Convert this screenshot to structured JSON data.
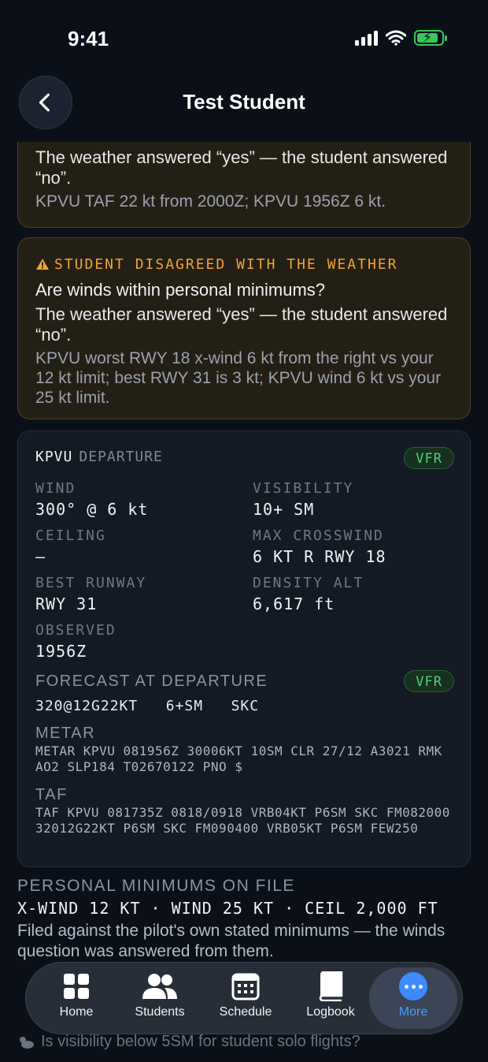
{
  "status_bar": {
    "time": "9:41"
  },
  "header": {
    "title": "Test Student"
  },
  "cards": [
    {
      "answer": "The weather answered “yes” — the student answered “no”.",
      "detail": "KPVU TAF 22 kt from 2000Z; KPVU 1956Z 6 kt."
    },
    {
      "warning": "STUDENT DISAGREED WITH THE WEATHER",
      "question": "Are winds within personal minimums?",
      "answer": "The weather answered “yes” — the student answered “no”.",
      "detail": "KPVU worst RWY 18 x-wind 6 kt from the right vs your 12 kt limit; best RWY 31 is 3 kt; KPVU wind 6 kt vs your 25 kt limit."
    }
  ],
  "weather": {
    "airport": "KPVU",
    "role": "DEPARTURE",
    "category": "VFR",
    "fields": {
      "wind": {
        "label": "WIND",
        "value": "300° @ 6 kt"
      },
      "visibility": {
        "label": "VISIBILITY",
        "value": "10+ SM"
      },
      "ceiling": {
        "label": "CEILING",
        "value": "—"
      },
      "max_crosswind": {
        "label": "MAX CROSSWIND",
        "value": "6 KT R RWY 18"
      },
      "best_runway": {
        "label": "BEST RUNWAY",
        "value": "RWY 31"
      },
      "density_alt": {
        "label": "DENSITY ALT",
        "value": "6,617 ft"
      },
      "observed": {
        "label": "OBSERVED",
        "value": "1956Z"
      }
    },
    "forecast_label": "FORECAST AT DEPARTURE",
    "forecast_category": "VFR",
    "forecast_value": "320@12G22KT   6+SM   SKC",
    "metar_label": "METAR",
    "metar": "METAR KPVU 081956Z 30006KT 10SM CLR 27/12 A3021 RMK AO2 SLP184 T02670122 PNO $",
    "taf_label": "TAF",
    "taf": "TAF KPVU 081735Z 0818/0918 VRB04KT P6SM SKC FM082000 32012G22KT P6SM SKC FM090400 VRB05KT P6SM FEW250"
  },
  "personal_minimums": {
    "label": "PERSONAL MINIMUMS ON FILE",
    "value": "X-WIND 12 KT · WIND 25 KT · CEIL 2,000 FT",
    "note": "Filed against the pilot's own stated minimums — the winds question was answered from them."
  },
  "partial_item": "Is visibility below 5SM for student solo flights?",
  "tabs": [
    {
      "label": "Home",
      "icon": "grid-icon"
    },
    {
      "label": "Students",
      "icon": "people-icon"
    },
    {
      "label": "Schedule",
      "icon": "calendar-icon"
    },
    {
      "label": "Logbook",
      "icon": "book-icon"
    },
    {
      "label": "More",
      "icon": "ellipsis-icon"
    }
  ],
  "colors": {
    "accent": "#3d8bff",
    "warning": "#f0a433",
    "vfr": "#4fd27a"
  }
}
